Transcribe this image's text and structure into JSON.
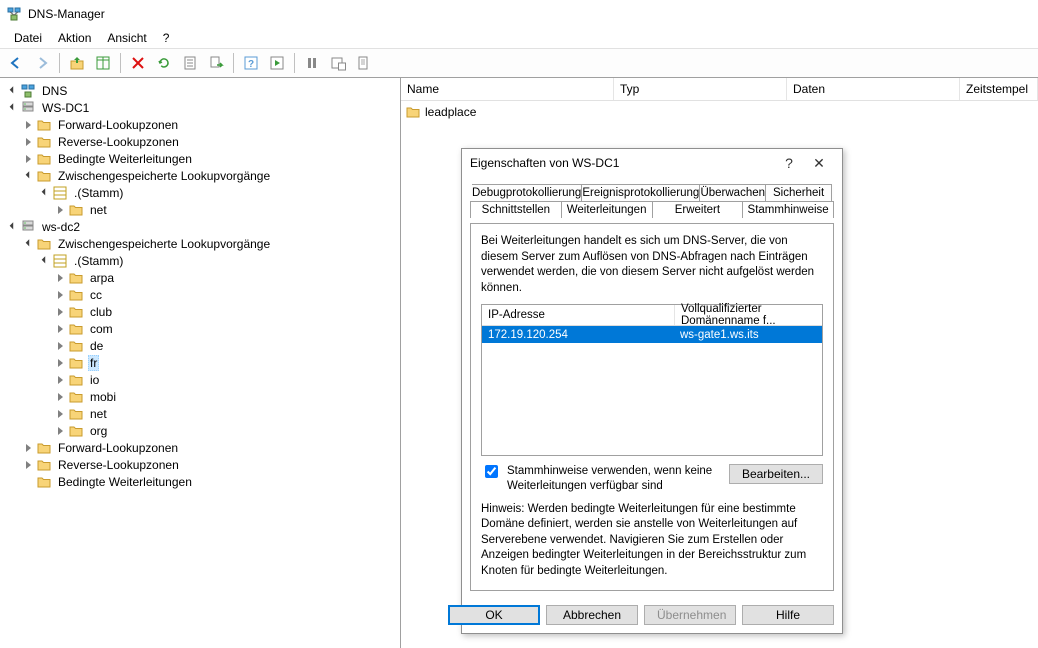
{
  "window": {
    "title": "DNS-Manager"
  },
  "menu": {
    "items": [
      "Datei",
      "Aktion",
      "Ansicht",
      "?"
    ]
  },
  "toolbar": {
    "back": "back-icon",
    "fwd": "forward-icon",
    "up": "up-icon",
    "showhide": "showhide-icon",
    "delete": "delete-icon",
    "refresh": "refresh-icon",
    "export": "export-icon",
    "run": "run-icon",
    "help": "help-icon",
    "play": "play-icon",
    "pause": "pause-icon",
    "stop": "stop-icon",
    "newzone": "newzone-icon"
  },
  "tree": {
    "root": "DNS",
    "servers": [
      {
        "name": "WS-DC1",
        "expanded": true,
        "children": [
          {
            "name": "Forward-Lookupzonen",
            "icon": "folder",
            "twisty": "closed"
          },
          {
            "name": "Reverse-Lookupzonen",
            "icon": "folder",
            "twisty": "closed"
          },
          {
            "name": "Bedingte Weiterleitungen",
            "icon": "folder",
            "twisty": "closed"
          },
          {
            "name": "Zwischengespeicherte Lookupvorgänge",
            "icon": "folder",
            "twisty": "open",
            "children": [
              {
                "name": ".(Stamm)",
                "icon": "zone",
                "twisty": "open",
                "children": [
                  {
                    "name": "net",
                    "icon": "folder",
                    "twisty": "closed"
                  }
                ]
              }
            ]
          }
        ]
      },
      {
        "name": "ws-dc2",
        "expanded": true,
        "children": [
          {
            "name": "Zwischengespeicherte Lookupvorgänge",
            "icon": "folder",
            "twisty": "open",
            "children": [
              {
                "name": ".(Stamm)",
                "icon": "zone",
                "twisty": "open",
                "children": [
                  {
                    "name": "arpa",
                    "icon": "folder",
                    "twisty": "closed"
                  },
                  {
                    "name": "cc",
                    "icon": "folder",
                    "twisty": "closed"
                  },
                  {
                    "name": "club",
                    "icon": "folder",
                    "twisty": "closed"
                  },
                  {
                    "name": "com",
                    "icon": "folder",
                    "twisty": "closed"
                  },
                  {
                    "name": "de",
                    "icon": "folder",
                    "twisty": "closed"
                  },
                  {
                    "name": "fr",
                    "icon": "folder",
                    "twisty": "closed",
                    "selected": true
                  },
                  {
                    "name": "io",
                    "icon": "folder",
                    "twisty": "closed"
                  },
                  {
                    "name": "mobi",
                    "icon": "folder",
                    "twisty": "closed"
                  },
                  {
                    "name": "net",
                    "icon": "folder",
                    "twisty": "closed"
                  },
                  {
                    "name": "org",
                    "icon": "folder",
                    "twisty": "closed"
                  }
                ]
              }
            ]
          },
          {
            "name": "Forward-Lookupzonen",
            "icon": "folder",
            "twisty": "closed"
          },
          {
            "name": "Reverse-Lookupzonen",
            "icon": "folder",
            "twisty": "closed"
          },
          {
            "name": "Bedingte Weiterleitungen",
            "icon": "folder",
            "twisty": "none"
          }
        ]
      }
    ]
  },
  "list": {
    "columns": [
      "Name",
      "Typ",
      "Daten",
      "Zeitstempel"
    ],
    "rows": [
      {
        "name": "leadplace"
      }
    ]
  },
  "dialog": {
    "title": "Eigenschaften von WS-DC1",
    "tabs_back": [
      "Debugprotokollierung",
      "Ereignisprotokollierung",
      "Überwachen",
      "Sicherheit"
    ],
    "tabs_front": [
      "Schnittstellen",
      "Weiterleitungen",
      "Erweitert",
      "Stammhinweise"
    ],
    "active_tab": "Weiterleitungen",
    "desc": "Bei Weiterleitungen handelt es sich um DNS-Server, die von diesem Server zum Auflösen von DNS-Abfragen nach Einträgen verwendet werden, die von diesem Server nicht aufgelöst werden können.",
    "col_ip": "IP-Adresse",
    "col_fqdn": "Vollqualifizierter Domänenname f...",
    "row_ip": "172.19.120.254",
    "row_fqdn": "ws-gate1.ws.its",
    "cb_label": "Stammhinweise verwenden, wenn keine Weiterleitungen verfügbar sind",
    "edit_btn": "Bearbeiten...",
    "note": "Hinweis: Werden bedingte Weiterleitungen für eine bestimmte Domäne definiert, werden sie anstelle von Weiterleitungen auf Serverebene verwendet. Navigieren Sie zum Erstellen oder Anzeigen bedingter Weiterleitungen in der Bereichsstruktur zum Knoten für bedingte Weiterleitungen.",
    "ok": "OK",
    "cancel": "Abbrechen",
    "apply": "Übernehmen",
    "help": "Hilfe"
  },
  "colors": {
    "accent": "#0078d7",
    "folder": "#f8d478",
    "folder_stroke": "#c99b2e"
  }
}
